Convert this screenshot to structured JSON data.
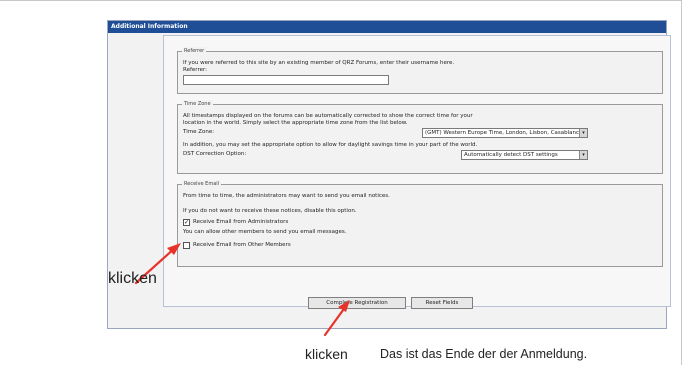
{
  "form": {
    "header": "Additional Information",
    "referrer": {
      "legend": "Referrer",
      "description": "If you were referred to this site by an existing member of QRZ Forums, enter their username here.",
      "label": "Referrer:",
      "value": ""
    },
    "timezone": {
      "legend": "Time Zone",
      "description_line1": "All timestamps displayed on the forums can be automatically corrected to show the correct time for your",
      "description_line2": "location in the world. Simply select the appropriate time zone from the list below.",
      "label": "Time Zone:",
      "selected": "(GMT) Western Europe Time, London, Lisbon, Casablanca",
      "dst_description": "In addition, you may set the appropriate option to allow for daylight savings time in your part of the world.",
      "dst_label": "DST Correction Option:",
      "dst_selected": "Automatically detect DST settings"
    },
    "email": {
      "legend": "Receive Email",
      "description": "From time to time, the administrators may want to send you email notices.",
      "disable_hint": "If you do not want to receive these notices, disable this option.",
      "admin_checkbox_label": "Receive Email from Administrators",
      "admin_checked": true,
      "members_hint": "You can allow other members to send you email messages.",
      "members_checkbox_label": "Receive Email from Other Members",
      "members_checked": false
    },
    "buttons": {
      "complete": "Complete Registration",
      "reset": "Reset Fields"
    }
  },
  "annotations": {
    "left_click": "klicken",
    "bottom_click": "klicken",
    "note": "Das ist das Ende der der Anmeldung."
  },
  "colors": {
    "header_bg": "#1f4e96",
    "arrow": "#e8332a"
  }
}
